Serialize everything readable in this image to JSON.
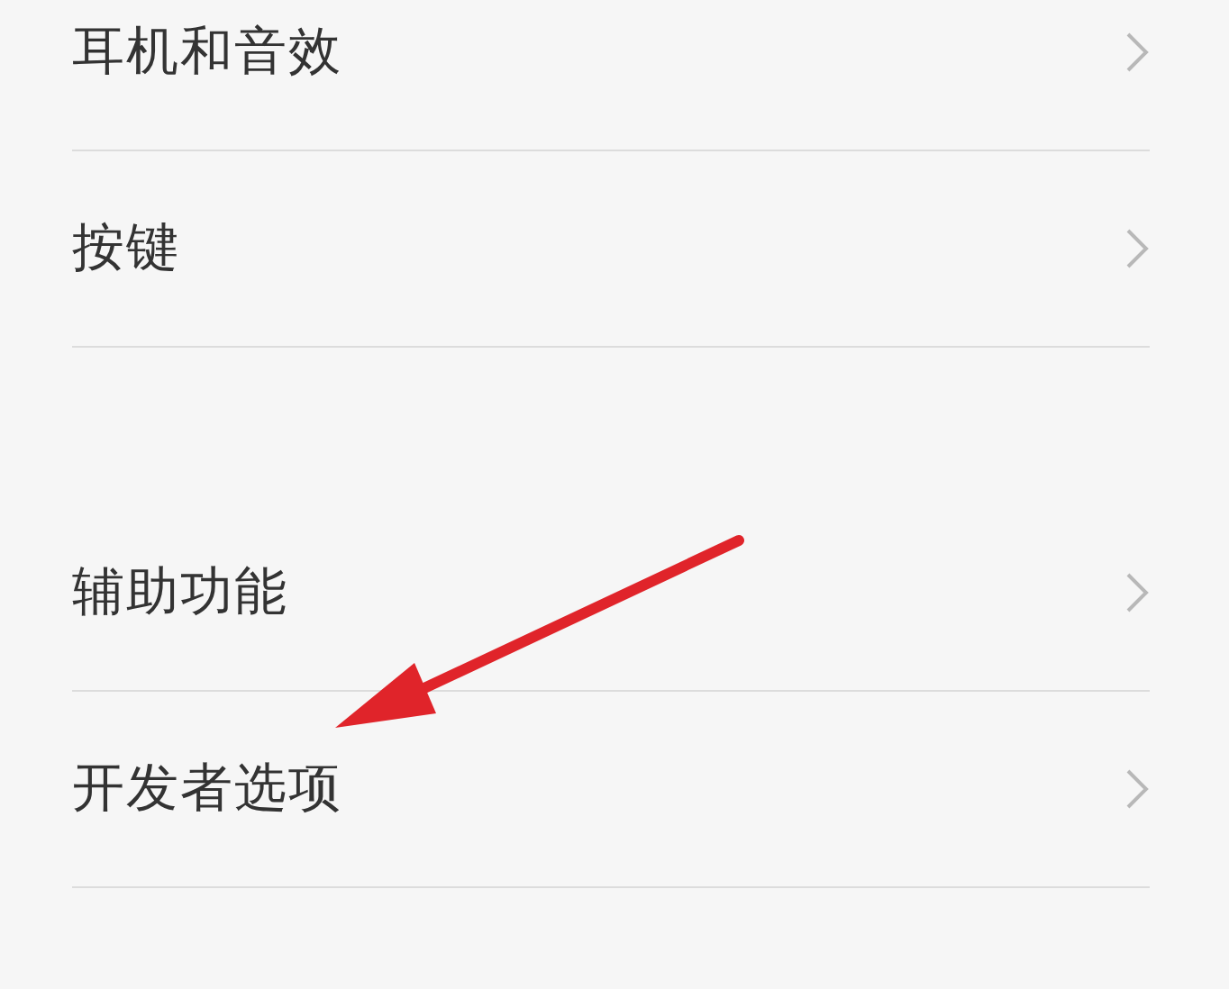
{
  "groups": [
    {
      "items": [
        {
          "label": "耳机和音效"
        },
        {
          "label": "按键"
        }
      ]
    },
    {
      "items": [
        {
          "label": "辅助功能"
        },
        {
          "label": "开发者选项"
        }
      ]
    }
  ]
}
